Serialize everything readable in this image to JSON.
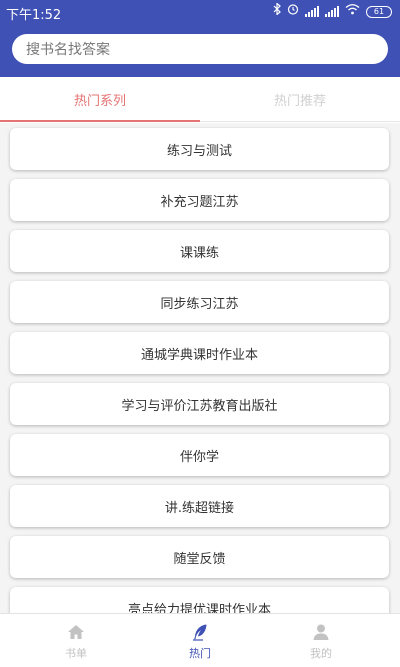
{
  "status_bar": {
    "time": "下午1:52",
    "battery": "61",
    "icons": [
      "bluetooth-icon",
      "alarm-icon",
      "cellular-icon",
      "wifi-icon",
      "battery-icon"
    ]
  },
  "search": {
    "placeholder": "搜书名找答案"
  },
  "tabs": [
    {
      "label": "热门系列",
      "active": true
    },
    {
      "label": "热门推荐",
      "active": false
    }
  ],
  "list": {
    "items": [
      "练习与测试",
      "补充习题江苏",
      "课课练",
      "同步练习江苏",
      "通城学典课时作业本",
      "学习与评价江苏教育出版社",
      "伴你学",
      "讲.练超链接",
      "随堂反馈",
      "亮点给力提优课时作业本"
    ]
  },
  "bottom_nav": [
    {
      "label": "书单",
      "icon": "home-icon",
      "active": false
    },
    {
      "label": "热门",
      "icon": "feather-icon",
      "active": true
    },
    {
      "label": "我的",
      "icon": "user-icon",
      "active": false
    }
  ],
  "colors": {
    "primary": "#3f51b5",
    "tab_active": "#e57373",
    "tab_inactive": "#d0d0d0",
    "nav_inactive": "#c2c2c2"
  }
}
